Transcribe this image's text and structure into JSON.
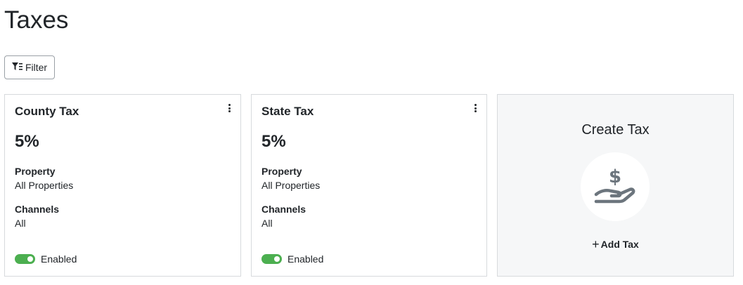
{
  "page": {
    "title": "Taxes"
  },
  "toolbar": {
    "filter_label": "Filter",
    "filter_icon": "filter-icon"
  },
  "cards": [
    {
      "title": "County Tax",
      "rate": "5%",
      "property_label": "Property",
      "property_value": "All Properties",
      "channels_label": "Channels",
      "channels_value": "All",
      "status_label": "Enabled",
      "enabled": true,
      "menu_icon": "kebab-menu-icon"
    },
    {
      "title": "State Tax",
      "rate": "5%",
      "property_label": "Property",
      "property_value": "All Properties",
      "channels_label": "Channels",
      "channels_value": "All",
      "status_label": "Enabled",
      "enabled": true,
      "menu_icon": "kebab-menu-icon"
    }
  ],
  "create": {
    "title": "Create Tax",
    "icon": "hand-dollar-icon",
    "add_label": "Add Tax"
  },
  "colors": {
    "toggle_on": "#4caf50",
    "icon_gray": "#6c757d",
    "create_bg": "#f6f7f8"
  }
}
